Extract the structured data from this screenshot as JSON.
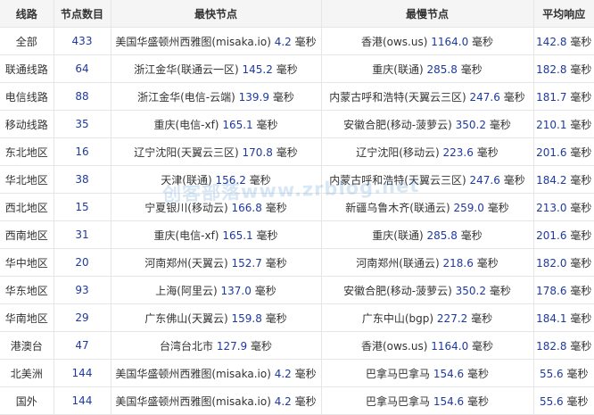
{
  "headers": {
    "route": "线路",
    "count": "节点数目",
    "fastest": "最快节点",
    "slowest": "最慢节点",
    "average": "平均响应"
  },
  "unit": "毫秒",
  "watermark": "创客部落www.zrblog.net",
  "rows": [
    {
      "route": "全部",
      "count": "433",
      "fast_name": "美国华盛顿州西雅图(misaka.io)",
      "fast_val": "4.2",
      "slow_name": "香港(ows.us)",
      "slow_val": "1164.0",
      "avg": "142.8"
    },
    {
      "route": "联通线路",
      "count": "64",
      "fast_name": "浙江金华(联通云一区)",
      "fast_val": "145.2",
      "slow_name": "重庆(联通)",
      "slow_val": "285.8",
      "avg": "182.8"
    },
    {
      "route": "电信线路",
      "count": "88",
      "fast_name": "浙江金华(电信-云端)",
      "fast_val": "139.9",
      "slow_name": "内蒙古呼和浩特(天翼云三区)",
      "slow_val": "247.6",
      "avg": "181.7"
    },
    {
      "route": "移动线路",
      "count": "35",
      "fast_name": "重庆(电信-xf)",
      "fast_val": "165.1",
      "slow_name": "安徽合肥(移动-菠萝云)",
      "slow_val": "350.2",
      "avg": "210.1"
    },
    {
      "route": "东北地区",
      "count": "16",
      "fast_name": "辽宁沈阳(天翼云三区)",
      "fast_val": "170.8",
      "slow_name": "辽宁沈阳(移动云)",
      "slow_val": "223.6",
      "avg": "201.6"
    },
    {
      "route": "华北地区",
      "count": "38",
      "fast_name": "天津(联通)",
      "fast_val": "156.2",
      "slow_name": "内蒙古呼和浩特(天翼云三区)",
      "slow_val": "247.6",
      "avg": "184.2"
    },
    {
      "route": "西北地区",
      "count": "15",
      "fast_name": "宁夏银川(移动云)",
      "fast_val": "166.8",
      "slow_name": "新疆乌鲁木齐(联通云)",
      "slow_val": "259.0",
      "avg": "213.0"
    },
    {
      "route": "西南地区",
      "count": "31",
      "fast_name": "重庆(电信-xf)",
      "fast_val": "165.1",
      "slow_name": "重庆(联通)",
      "slow_val": "285.8",
      "avg": "201.6"
    },
    {
      "route": "华中地区",
      "count": "20",
      "fast_name": "河南郑州(天翼云)",
      "fast_val": "152.7",
      "slow_name": "河南郑州(联通云)",
      "slow_val": "218.6",
      "avg": "182.0"
    },
    {
      "route": "华东地区",
      "count": "93",
      "fast_name": "上海(阿里云)",
      "fast_val": "137.0",
      "slow_name": "安徽合肥(移动-菠萝云)",
      "slow_val": "350.2",
      "avg": "178.6"
    },
    {
      "route": "华南地区",
      "count": "29",
      "fast_name": "广东佛山(天翼云)",
      "fast_val": "159.8",
      "slow_name": "广东中山(bgp)",
      "slow_val": "227.2",
      "avg": "184.1"
    },
    {
      "route": "港澳台",
      "count": "47",
      "fast_name": "台湾台北市",
      "fast_val": "127.9",
      "slow_name": "香港(ows.us)",
      "slow_val": "1164.0",
      "avg": "182.8"
    },
    {
      "route": "北美洲",
      "count": "144",
      "fast_name": "美国华盛顿州西雅图(misaka.io)",
      "fast_val": "4.2",
      "slow_name": "巴拿马巴拿马",
      "slow_val": "154.6",
      "avg": "55.6"
    },
    {
      "route": "国外",
      "count": "144",
      "fast_name": "美国华盛顿州西雅图(misaka.io)",
      "fast_val": "4.2",
      "slow_name": "巴拿马巴拿马",
      "slow_val": "154.6",
      "avg": "55.6"
    }
  ]
}
